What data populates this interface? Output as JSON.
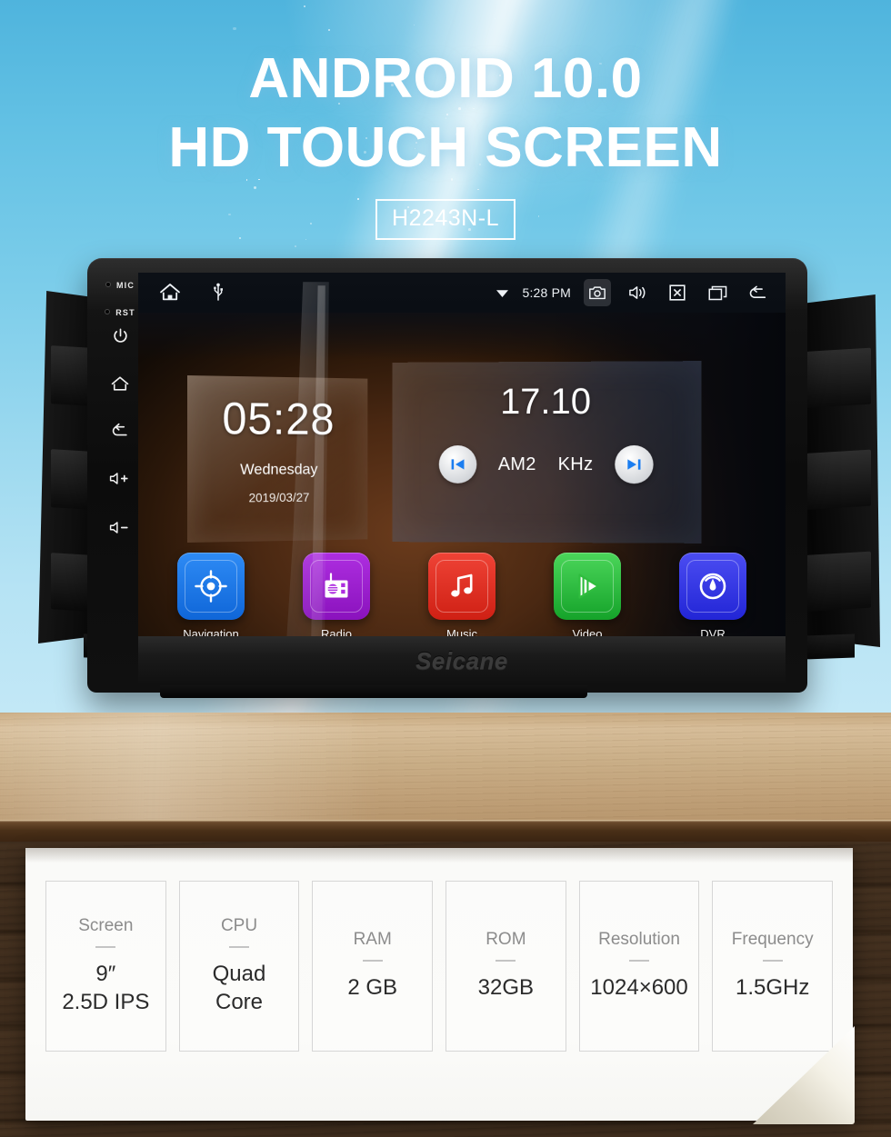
{
  "hero": {
    "line1": "ANDROID 10.0",
    "line2": "HD TOUCH SCREEN",
    "model": "H2243N-L"
  },
  "device": {
    "brand_logo": "Seicane",
    "side_keys": [
      {
        "id": "mic",
        "label": "MIC",
        "icon": "microphone-hole-icon"
      },
      {
        "id": "rst",
        "label": "RST",
        "icon": "reset-hole-icon"
      },
      {
        "id": "power",
        "label": "",
        "icon": "power-icon"
      },
      {
        "id": "home",
        "label": "",
        "icon": "home-icon"
      },
      {
        "id": "back",
        "label": "",
        "icon": "back-arrow-icon"
      },
      {
        "id": "vol-up",
        "label": "",
        "icon": "volume-up-icon"
      },
      {
        "id": "vol-down",
        "label": "",
        "icon": "volume-down-icon"
      }
    ],
    "statusbar": {
      "time": "5:28 PM",
      "left_icons": [
        "home-icon",
        "usb-icon"
      ],
      "right_icons": [
        "wifi-icon",
        "camera-icon",
        "volume-icon",
        "close-x-icon",
        "recents-icon",
        "back-arrow-icon"
      ],
      "active_icon": "camera-icon"
    },
    "clock_widget": {
      "time": "05:28",
      "weekday": "Wednesday",
      "date": "2019/03/27"
    },
    "radio_widget": {
      "frequency": "17.10",
      "band": "AM2",
      "unit": "KHz",
      "prev_icon": "skip-previous-icon",
      "next_icon": "skip-next-icon"
    },
    "apps": [
      {
        "label": "Navigation",
        "icon": "navigation-target-icon",
        "color": "#1878ea"
      },
      {
        "label": "Radio",
        "icon": "radio-icon",
        "color": "#9b1ecd"
      },
      {
        "label": "Music",
        "icon": "music-note-icon",
        "color": "#e03325"
      },
      {
        "label": "Video",
        "icon": "video-play-icon",
        "color": "#2fbd3e"
      },
      {
        "label": "DVR",
        "icon": "dvr-gauge-icon",
        "color": "#3436e8"
      }
    ]
  },
  "specs": [
    {
      "label": "Screen",
      "value": "9″\n2.5D IPS"
    },
    {
      "label": "CPU",
      "value": "Quad\nCore"
    },
    {
      "label": "RAM",
      "value": "2 GB"
    },
    {
      "label": "ROM",
      "value": "32GB"
    },
    {
      "label": "Resolution",
      "value": "1024×600"
    },
    {
      "label": "Frequency",
      "value": "1.5GHz"
    }
  ]
}
